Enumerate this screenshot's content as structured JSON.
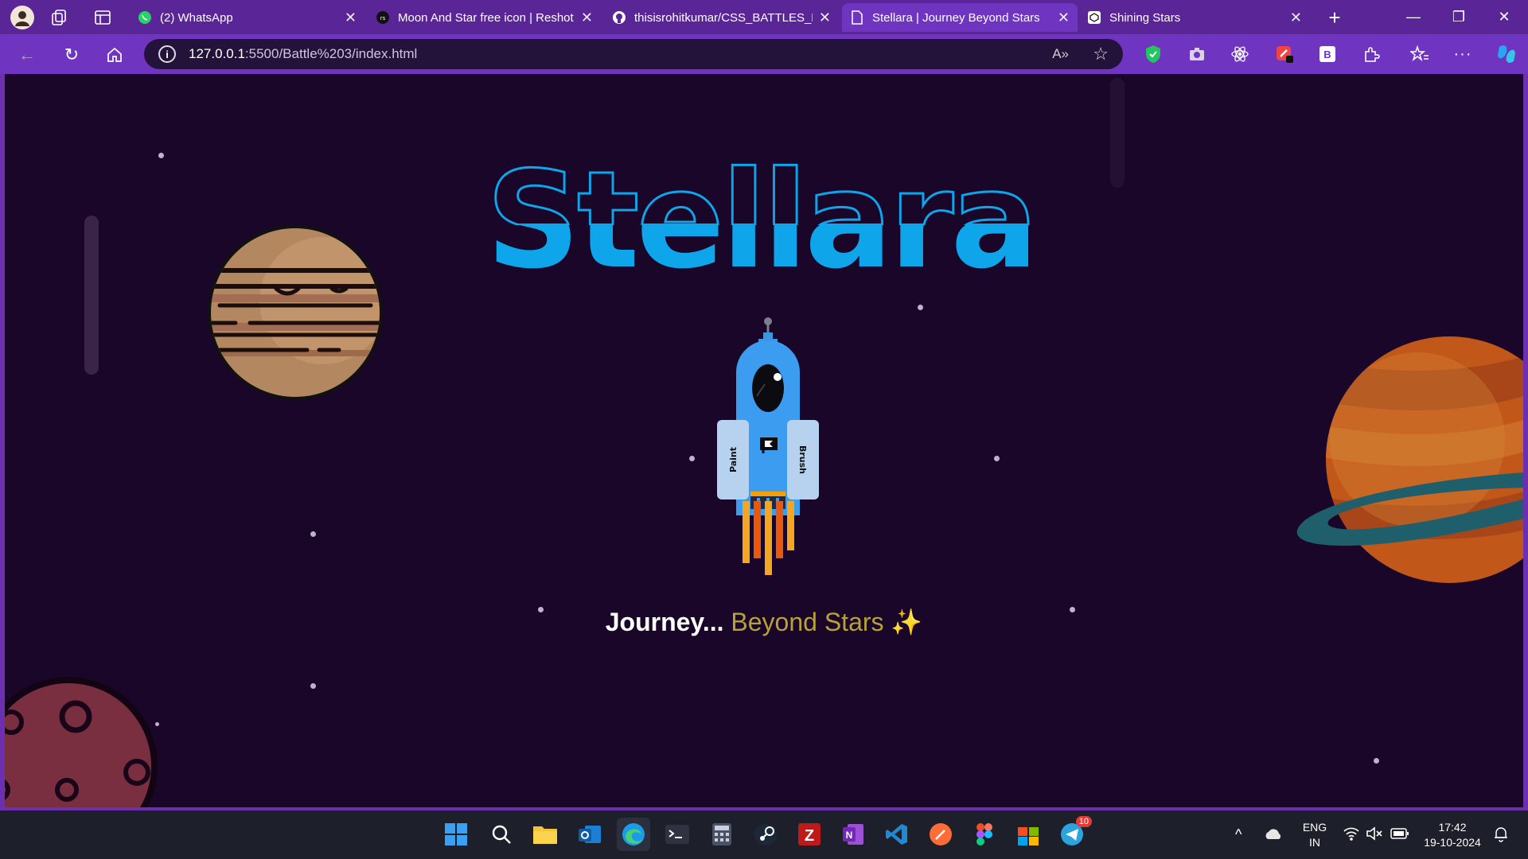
{
  "browser": {
    "tabs": [
      {
        "label": "(2) WhatsApp",
        "icon": "whatsapp-icon"
      },
      {
        "label": "Moon And Star free icon | Reshot",
        "icon": "reshot-icon"
      },
      {
        "label": "thisisrohitkumar/CSS_BATTLES_BA",
        "icon": "github-icon"
      },
      {
        "label": "Stellara | Journey Beyond Stars",
        "icon": "page-icon",
        "active": true
      },
      {
        "label": "Shining Stars",
        "icon": "codepen-icon"
      }
    ],
    "url_host": "127.0.0.1",
    "url_path": ":5500/Battle%203/index.html"
  },
  "page": {
    "title": "Stellara",
    "tagline_white": "Journey...",
    "tagline_gold": "Beyond Stars",
    "tagline_emoji": "✨",
    "rocket_left_label": "Paint",
    "rocket_right_label": "Brush"
  },
  "colors": {
    "background": "#1a0629",
    "title_blue": "#0ea5ea",
    "accent_purple": "#6f35c0"
  },
  "taskbar": {
    "lang_top": "ENG",
    "lang_bottom": "IN",
    "time": "17:42",
    "date": "19-10-2024",
    "telegram_badge": "10"
  }
}
